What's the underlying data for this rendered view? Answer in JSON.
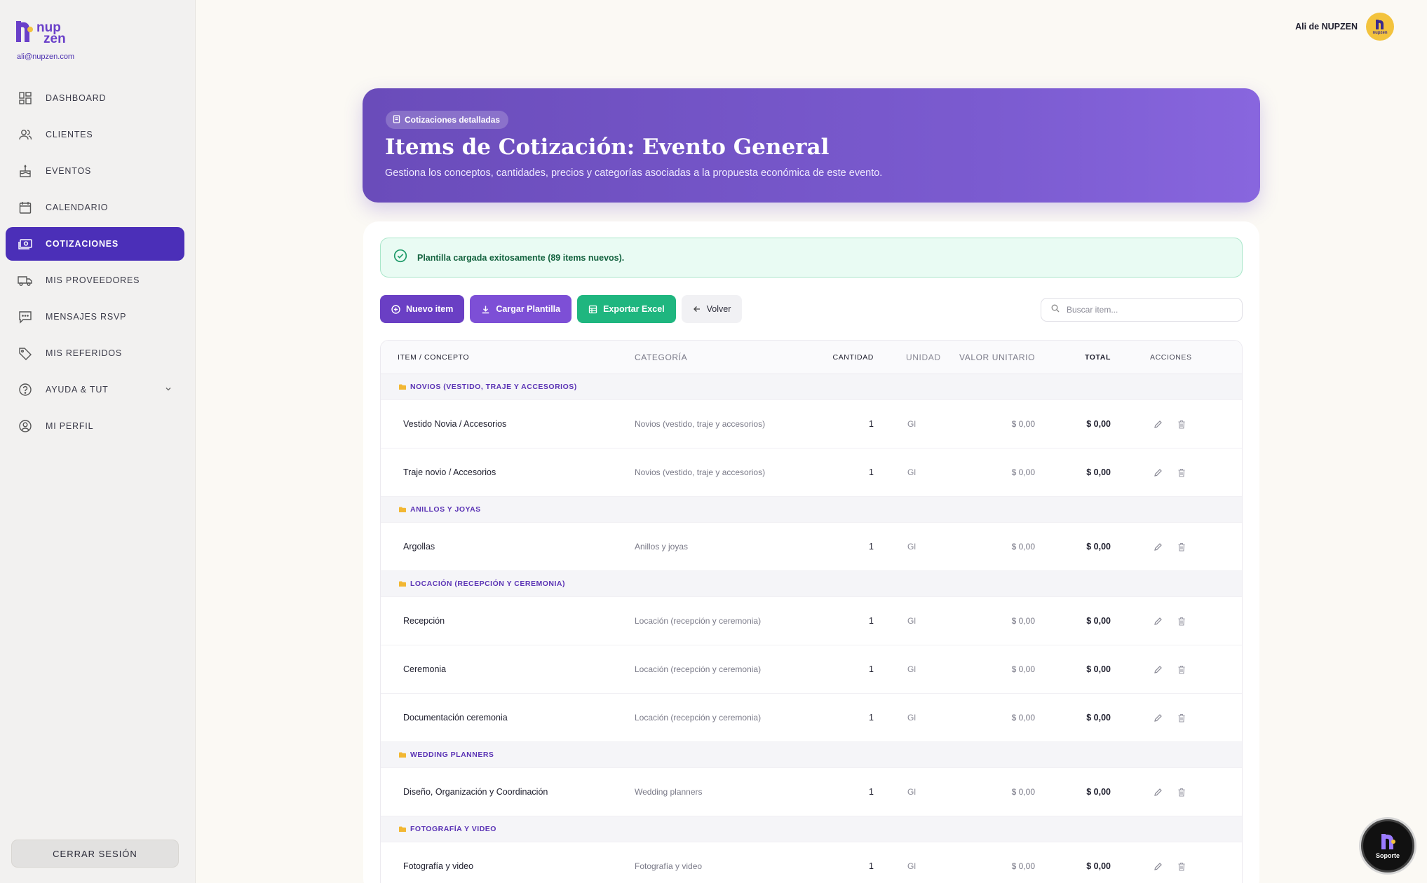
{
  "brand": {
    "line1": "nup",
    "line2": "zen",
    "email": "ali@nupzen.com",
    "color": "#6a40c9"
  },
  "sidebar": {
    "items": [
      {
        "label": "DASHBOARD",
        "icon": "dashboard-icon"
      },
      {
        "label": "CLIENTES",
        "icon": "users-icon"
      },
      {
        "label": "EVENTOS",
        "icon": "cake-icon"
      },
      {
        "label": "CALENDARIO",
        "icon": "calendar-icon"
      },
      {
        "label": "COTIZACIONES",
        "icon": "money-icon",
        "active": true
      },
      {
        "label": "MIS PROVEEDORES",
        "icon": "truck-icon"
      },
      {
        "label": "MENSAJES RSVP",
        "icon": "message-icon"
      },
      {
        "label": "MIS REFERIDOS",
        "icon": "tag-icon"
      },
      {
        "label": "AYUDA & TUT",
        "icon": "help-icon"
      },
      {
        "label": "MI PERFIL",
        "icon": "profile-icon"
      }
    ],
    "logout": "CERRAR SESIÓN"
  },
  "user": {
    "name": "Ali de NUPZEN",
    "avatar_text": "nupzen"
  },
  "hero": {
    "badge": "Cotizaciones detalladas",
    "title": "Items de Cotización: Evento General",
    "subtitle": "Gestiona los conceptos, cantidades, precios y categorías asociadas a la propuesta económica de este evento."
  },
  "alert": {
    "text": "Plantilla cargada exitosamente (89 items nuevos)."
  },
  "toolbar": {
    "new_item": "Nuevo item",
    "load_template": "Cargar Plantilla",
    "export_excel": "Exportar Excel",
    "back": "Volver"
  },
  "search": {
    "placeholder": "Buscar item..."
  },
  "table": {
    "headers": {
      "item": "ITEM / CONCEPTO",
      "category": "CATEGORÍA",
      "qty": "CANTIDAD",
      "unit": "UNIDAD",
      "unit_value": "VALOR UNITARIO",
      "total": "TOTAL",
      "actions": "ACCIONES"
    },
    "groups": [
      {
        "name": "NOVIOS (VESTIDO, TRAJE Y ACCESORIOS)",
        "items": [
          {
            "concept": "Vestido Novia / Accesorios",
            "category": "Novios (vestido, traje y accesorios)",
            "qty": "1",
            "unit": "Gl",
            "unit_value": "$ 0,00",
            "total": "$ 0,00"
          },
          {
            "concept": "Traje novio / Accesorios",
            "category": "Novios (vestido, traje y accesorios)",
            "qty": "1",
            "unit": "Gl",
            "unit_value": "$ 0,00",
            "total": "$ 0,00"
          }
        ]
      },
      {
        "name": "ANILLOS Y JOYAS",
        "items": [
          {
            "concept": "Argollas",
            "category": "Anillos y joyas",
            "qty": "1",
            "unit": "Gl",
            "unit_value": "$ 0,00",
            "total": "$ 0,00"
          }
        ]
      },
      {
        "name": "LOCACIÓN (RECEPCIÓN Y CEREMONIA)",
        "items": [
          {
            "concept": "Recepción",
            "category": "Locación (recepción y ceremonia)",
            "qty": "1",
            "unit": "Gl",
            "unit_value": "$ 0,00",
            "total": "$ 0,00"
          },
          {
            "concept": "Ceremonia",
            "category": "Locación (recepción y ceremonia)",
            "qty": "1",
            "unit": "Gl",
            "unit_value": "$ 0,00",
            "total": "$ 0,00"
          },
          {
            "concept": "Documentación ceremonia",
            "category": "Locación (recepción y ceremonia)",
            "qty": "1",
            "unit": "Gl",
            "unit_value": "$ 0,00",
            "total": "$ 0,00"
          }
        ]
      },
      {
        "name": "WEDDING PLANNERS",
        "items": [
          {
            "concept": "Diseño, Organización y Coordinación",
            "category": "Wedding planners",
            "qty": "1",
            "unit": "Gl",
            "unit_value": "$ 0,00",
            "total": "$ 0,00"
          }
        ]
      },
      {
        "name": "FOTOGRAFÍA Y VIDEO",
        "items": [
          {
            "concept": "Fotografía y video",
            "category": "Fotografía y video",
            "qty": "1",
            "unit": "Gl",
            "unit_value": "$ 0,00",
            "total": "$ 0,00"
          }
        ]
      }
    ]
  },
  "support": {
    "label": "Soporte"
  },
  "colors": {
    "accent": "#4b2fb8",
    "hero": "#7357c8",
    "success": "#1fb67f",
    "alert_bg": "#e9fbf3"
  }
}
